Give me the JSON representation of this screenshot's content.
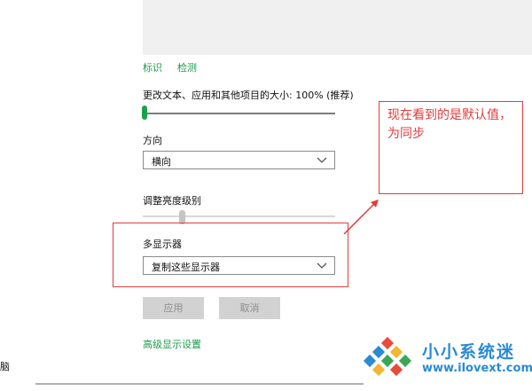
{
  "links": {
    "identify": "标识",
    "detect": "检测"
  },
  "scale": {
    "label": "更改文本、应用和其他项目的大小: 100% (推荐)",
    "value_percent": 100,
    "level_fraction": 0.0
  },
  "orientation": {
    "label": "方向",
    "selected": "横向"
  },
  "brightness": {
    "label": "调整亮度级别"
  },
  "multi_display": {
    "label": "多显示器",
    "selected": "复制这些显示器"
  },
  "buttons": {
    "apply": "应用",
    "cancel": "取消"
  },
  "advanced_link": "高级显示设置",
  "side_fragment": "脑",
  "annotation": {
    "text": "现在看到的是默认值，为同步"
  },
  "watermark": {
    "name": "小小系统迷",
    "url": "www.ilovext.com"
  },
  "colors": {
    "accent": "#17a34a",
    "link": "#1a9c4a",
    "annotation": "#e33b3b",
    "watermark": "#2a8ad4",
    "button_disabled": "#d2d2d2"
  },
  "icons": {
    "dropdown": "chevron-down-icon",
    "watermark_logo": "diamond-logo-icon"
  }
}
